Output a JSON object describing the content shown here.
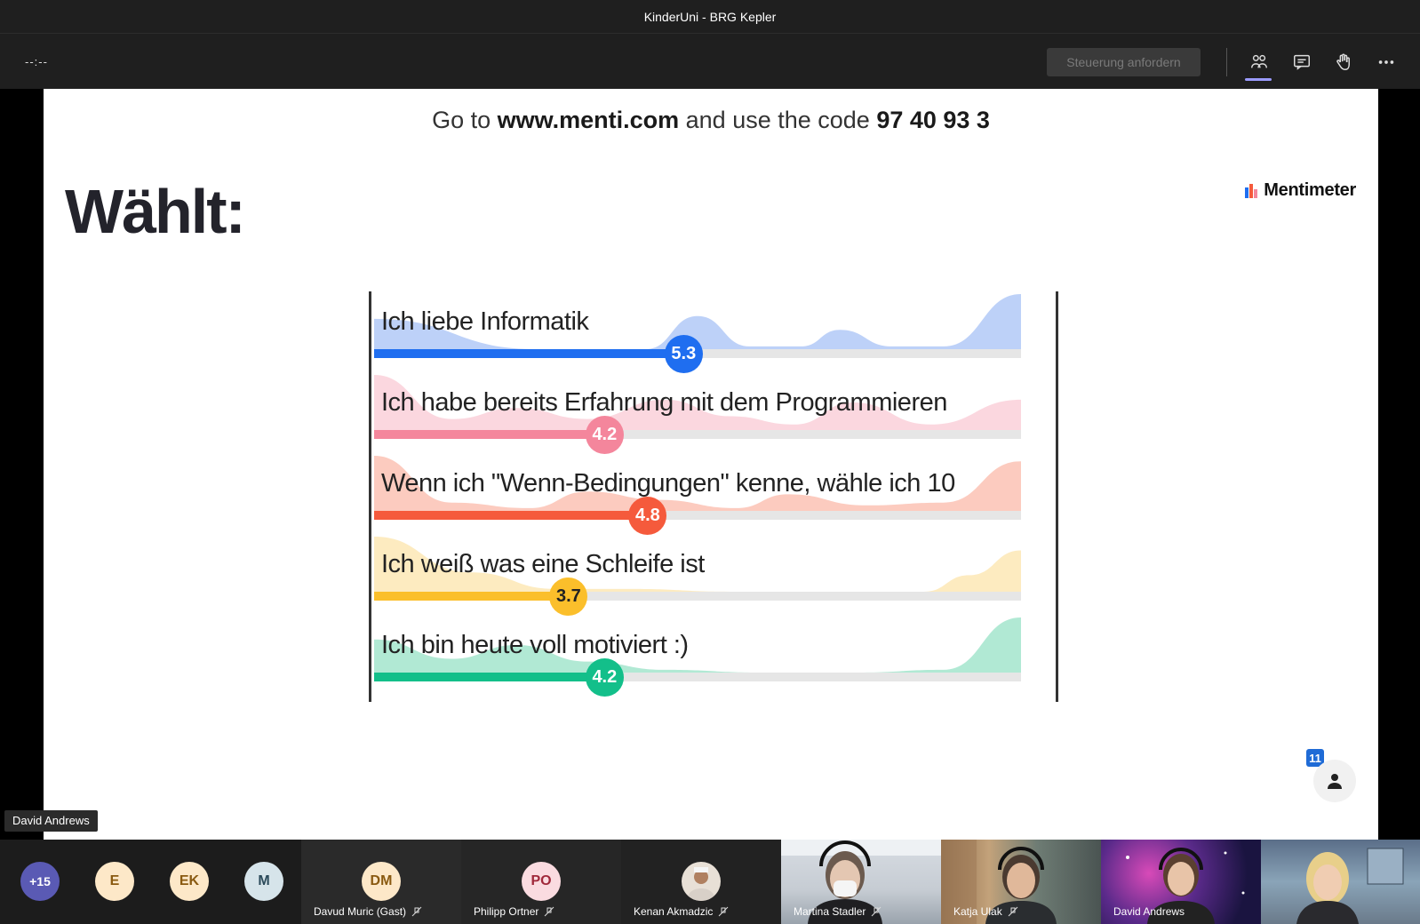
{
  "window": {
    "title": "KinderUni - BRG Kepler"
  },
  "controls": {
    "timer": "--:--",
    "request_control": "Steuerung anfordern"
  },
  "slide": {
    "join_prefix": "Go to ",
    "join_url": "www.menti.com",
    "join_middle": " and use the code ",
    "join_code": "97 40 93 3",
    "brand": "Mentimeter",
    "title": "Wählt:",
    "participant_count": "11"
  },
  "chart_data": {
    "type": "bar",
    "categories": [
      "Ich liebe Informatik",
      "Ich habe bereits Erfahrung mit dem Programmieren",
      "Wenn ich \"Wenn-Bedingungen\" kenne, wähle ich 10",
      "Ich weiß was eine Schleife ist",
      "Ich bin heute voll motiviert :)"
    ],
    "values": [
      5.3,
      4.2,
      4.8,
      3.7,
      4.2
    ],
    "value_labels": [
      "5.3",
      "4.2",
      "4.8",
      "3.7",
      "4.2"
    ],
    "colors": [
      "#1f6ef0",
      "#f4869c",
      "#f55a3c",
      "#fbbf2b",
      "#13bf8a"
    ],
    "soft_colors": [
      "#b6ccf7",
      "#fbd3dc",
      "#fcc5b8",
      "#fde9b9",
      "#a8e7cf"
    ],
    "xlim": [
      1,
      10
    ]
  },
  "presenter": "David Andrews",
  "strip": {
    "overflow": "+15",
    "avatars": [
      {
        "initials": "E",
        "bg": "#fde8c8",
        "fg": "#8a5a10"
      },
      {
        "initials": "EK",
        "bg": "#fde8c8",
        "fg": "#8a5a10"
      },
      {
        "initials": "M",
        "bg": "#d6e4ea",
        "fg": "#2b4a5a"
      }
    ],
    "tiles": [
      {
        "initials": "DM",
        "name": "Davud Muric (Gast)",
        "bg": "#fde8c8",
        "fg": "#8a5a10"
      },
      {
        "initials": "PO",
        "name": "Philipp Ortner",
        "bg": "#fadbe0",
        "fg": "#a0283a"
      },
      {
        "initials": "",
        "name": "Kenan Akmadzic",
        "bg": "#e8e0d6",
        "fg": "#444"
      }
    ],
    "videos": [
      {
        "name": "Martina Stadler"
      },
      {
        "name": "Katja Ulak"
      },
      {
        "name": "David Andrews"
      },
      {
        "name": ""
      }
    ]
  }
}
